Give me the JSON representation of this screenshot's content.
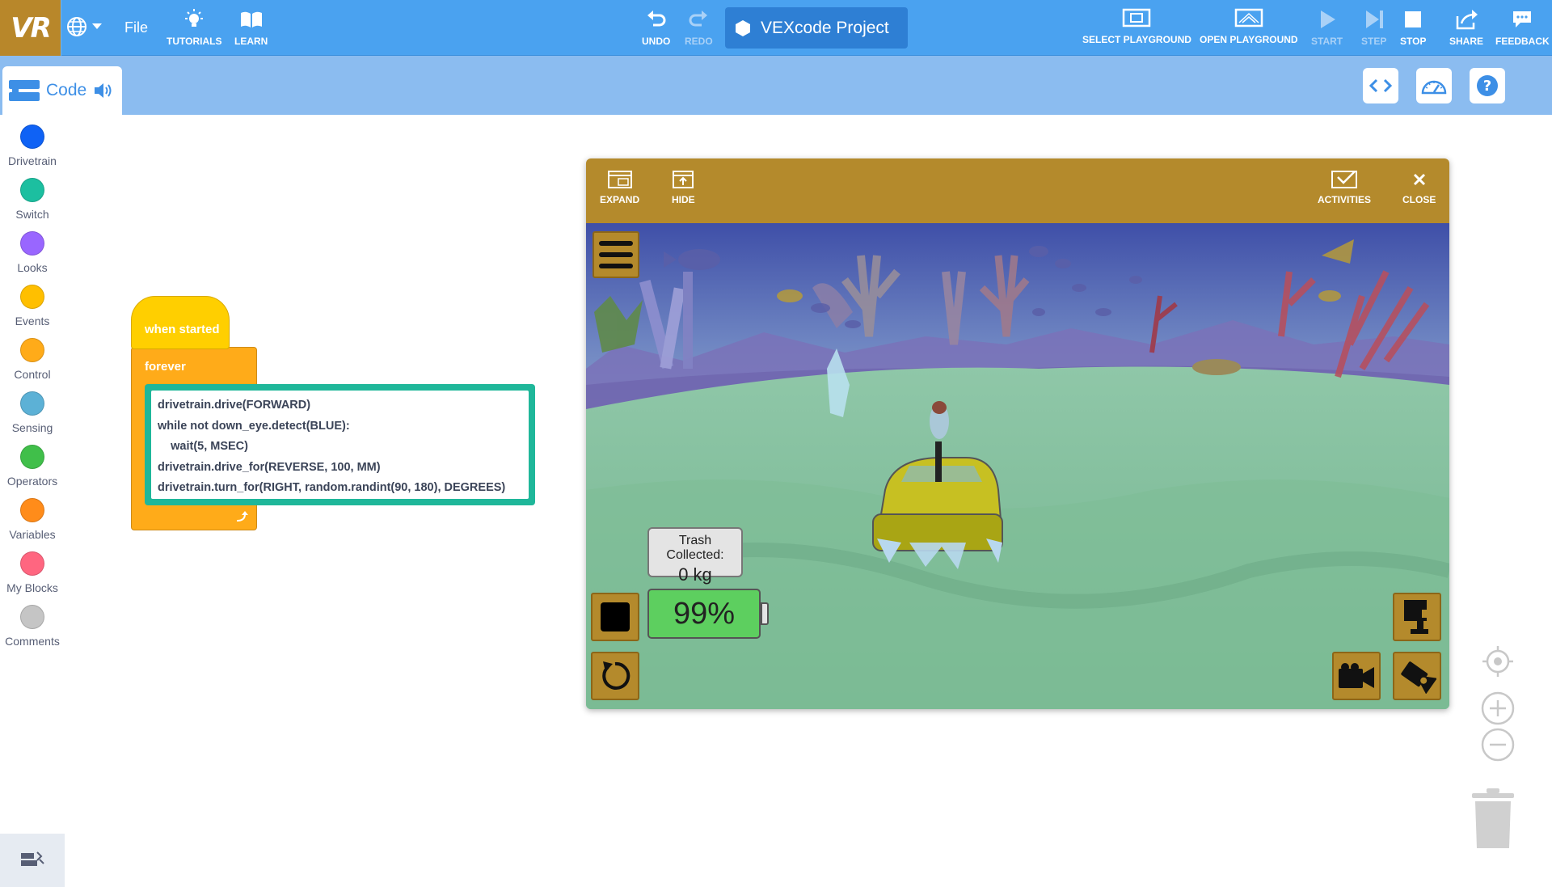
{
  "app": {
    "logo": "VR"
  },
  "topbar": {
    "file": "File",
    "tutorials": "TUTORIALS",
    "learn": "LEARN",
    "undo": "UNDO",
    "redo": "REDO",
    "project_title": "VEXcode Project",
    "select_playground": "SELECT PLAYGROUND",
    "open_playground": "OPEN PLAYGROUND",
    "start": "START",
    "step": "STEP",
    "stop": "STOP",
    "share": "SHARE",
    "feedback": "FEEDBACK"
  },
  "tabs": {
    "code": "Code"
  },
  "categories": [
    {
      "label": "Drivetrain",
      "color": "#0f62f5"
    },
    {
      "label": "Switch",
      "color": "#1cbfa0"
    },
    {
      "label": "Looks",
      "color": "#9966ff"
    },
    {
      "label": "Events",
      "color": "#ffbf00"
    },
    {
      "label": "Control",
      "color": "#ffab19"
    },
    {
      "label": "Sensing",
      "color": "#5cb1d6"
    },
    {
      "label": "Operators",
      "color": "#40bf4a"
    },
    {
      "label": "Variables",
      "color": "#ff8c1a"
    },
    {
      "label": "My Blocks",
      "color": "#ff6680"
    },
    {
      "label": "Comments",
      "color": "#c5c5c5"
    }
  ],
  "blocks": {
    "hat": "when started",
    "forever": "forever",
    "python_lines": [
      "drivetrain.drive(FORWARD)",
      "while not down_eye.detect(BLUE):",
      "    wait(5, MSEC)",
      "drivetrain.drive_for(REVERSE, 100, MM)",
      "drivetrain.turn_for(RIGHT, random.randint(90, 180), DEGREES)"
    ]
  },
  "playground": {
    "expand": "EXPAND",
    "hide": "HIDE",
    "activities": "ACTIVITIES",
    "close": "CLOSE",
    "trash_label": "Trash Collected:",
    "trash_value": "0 kg",
    "battery": "99%",
    "battery_level": 0.99
  },
  "colors": {
    "topbar": "#4aa2f0",
    "tabbar": "#8bbcf0",
    "playground_chrome": "#b48a2c",
    "python_block": "#1fb79a"
  }
}
